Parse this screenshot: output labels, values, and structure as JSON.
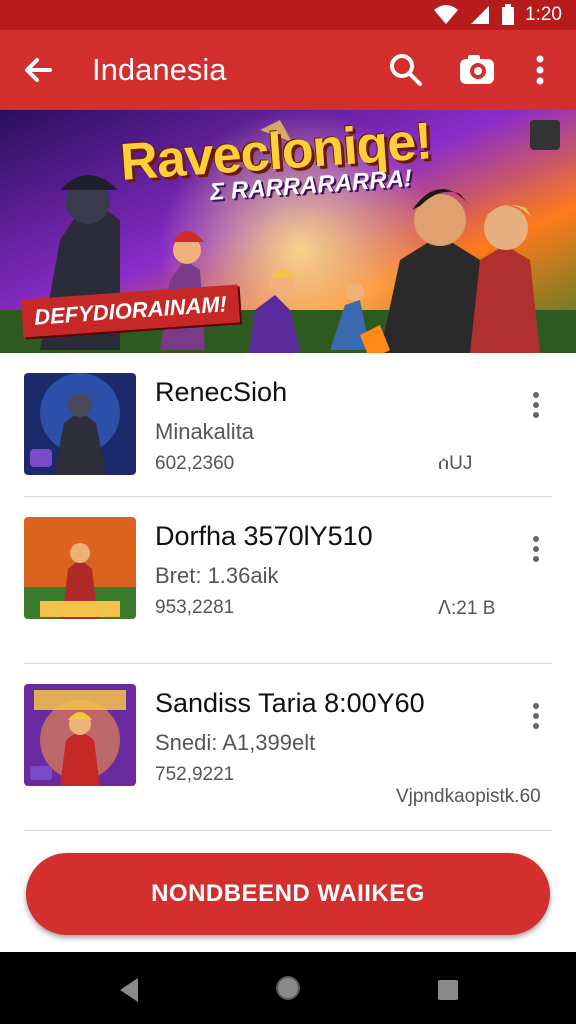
{
  "status_bar": {
    "time": "1:20",
    "icons": [
      "wifi-icon",
      "signal-icon",
      "battery-icon"
    ]
  },
  "app_bar": {
    "title": "Indanesia",
    "icons": [
      "back-arrow-icon",
      "search-icon",
      "camera-icon",
      "more-vert-icon"
    ]
  },
  "banner": {
    "title": "Ravecloniqe!",
    "subtitle": "Ʃ RARRARARRA!",
    "ribbon": "DEFYDIORAINAM!"
  },
  "items": [
    {
      "title": "RenecSioh",
      "subtitle": "Minakalita",
      "meta": "602,2360",
      "right": "ሰUJ"
    },
    {
      "title": "Dorfha 3570lY510",
      "subtitle": "Bret: 1.36aik",
      "meta": "953,2281",
      "right": "ꓥ:21 B"
    },
    {
      "title": "Sandiss Taria 8:00Y60",
      "subtitle": "Snedi: A1,399elt",
      "meta": "752,9221",
      "right": "Vjpndkaopistk.60"
    }
  ],
  "cta": {
    "label": "NONDBEEND WAIIKEG"
  },
  "colors": {
    "primary": "#d32f2f",
    "status": "#b71c1c",
    "nav": "#000000"
  },
  "nav_bar": {
    "icons": [
      "nav-back-icon",
      "nav-home-icon",
      "nav-recent-icon"
    ]
  }
}
